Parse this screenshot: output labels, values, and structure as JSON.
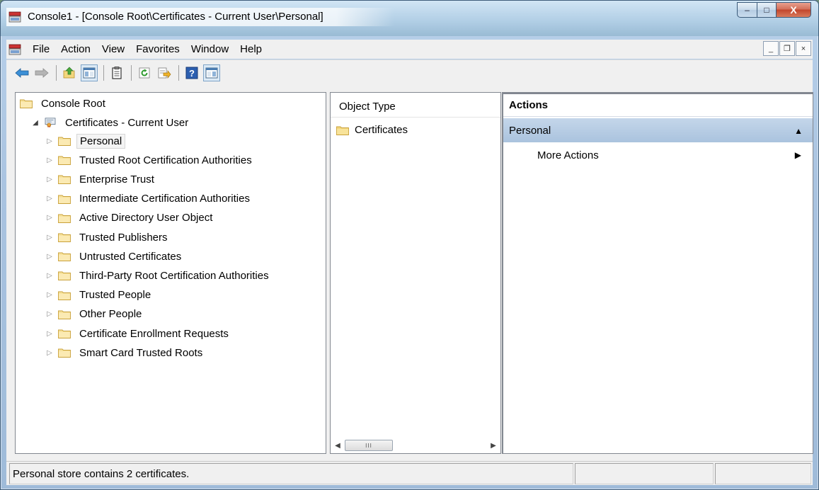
{
  "window": {
    "title": "Console1 - [Console Root\\Certificates - Current User\\Personal]",
    "caption_minimize": "–",
    "caption_maximize": "□",
    "caption_close": "X"
  },
  "menu": {
    "items": [
      "File",
      "Action",
      "View",
      "Favorites",
      "Window",
      "Help"
    ],
    "mdi_minimize": "_",
    "mdi_restore": "❐",
    "mdi_close": "×"
  },
  "toolbar": {
    "buttons": [
      {
        "name": "back-icon",
        "pressed": false
      },
      {
        "name": "forward-icon",
        "pressed": false
      },
      {
        "name": "up-one-level-icon",
        "pressed": false
      },
      {
        "name": "show-hide-console-tree-icon",
        "pressed": true
      },
      {
        "name": "properties-icon",
        "pressed": false
      },
      {
        "name": "refresh-icon",
        "pressed": false
      },
      {
        "name": "export-list-icon",
        "pressed": false
      },
      {
        "name": "help-icon",
        "pressed": false
      },
      {
        "name": "show-hide-action-pane-icon",
        "pressed": true
      }
    ]
  },
  "tree": {
    "root": "Console Root",
    "snapin": "Certificates - Current User",
    "stores": [
      "Personal",
      "Trusted Root Certification Authorities",
      "Enterprise Trust",
      "Intermediate Certification Authorities",
      "Active Directory User Object",
      "Trusted Publishers",
      "Untrusted Certificates",
      "Third-Party Root Certification Authorities",
      "Trusted People",
      "Other People",
      "Certificate Enrollment Requests",
      "Smart Card Trusted Roots"
    ],
    "selected": "Personal"
  },
  "list": {
    "column_header": "Object Type",
    "items": [
      "Certificates"
    ],
    "scroll_thumb_grip": "III"
  },
  "actions": {
    "header": "Actions",
    "section": "Personal",
    "items": [
      "More Actions"
    ]
  },
  "status": {
    "text": "Personal store contains 2 certificates."
  },
  "colors": {
    "accent": "#aac3de",
    "folder": "#f3d67c",
    "close_button": "#c3452c"
  }
}
